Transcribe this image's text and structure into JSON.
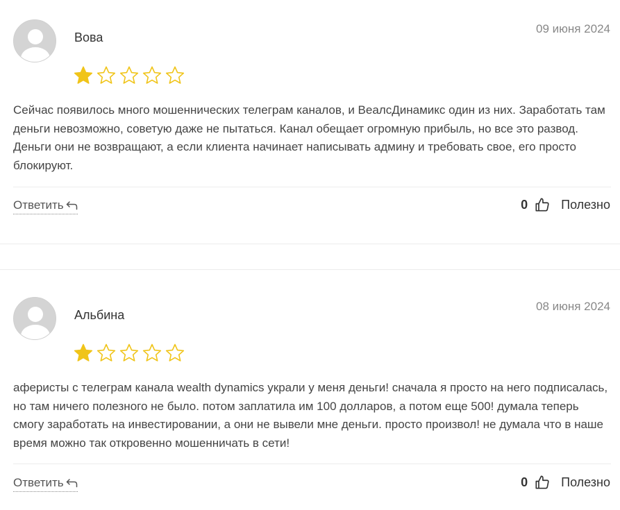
{
  "reviews": [
    {
      "author": "Вова",
      "date": "09 июня 2024",
      "rating": 1,
      "max_rating": 5,
      "text": "Сейчас появилось много мошеннических телеграм каналов, и ВеалсДинамикс один из них. Заработать там деньги невозможно, советую даже не пытаться. Канал обещает огромную прибыль, но все это развод. Деньги они не возвращают, а если клиента начинает написывать админу и требовать свое, его просто блокируют.",
      "reply_label": "Ответить",
      "useful_count": "0",
      "useful_label": "Полезно"
    },
    {
      "author": "Альбина",
      "date": "08 июня 2024",
      "rating": 1,
      "max_rating": 5,
      "text": "аферисты с телеграм канала wealth dynamics украли у меня деньги! сначала я просто на него подписалась, но там ничего полезного не было. потом заплатила им 100 долларов, а потом еще 500! думала теперь смогу заработать на инвестировании, а они не вывели мне деньги. просто произвол! не думала что в наше время можно так откровенно мошенничать в сети!",
      "reply_label": "Ответить",
      "useful_count": "0",
      "useful_label": "Полезно"
    }
  ],
  "icons": {
    "avatar": "default-user-avatar",
    "star_filled": "star-filled-icon",
    "star_empty": "star-outline-icon",
    "reply": "reply-arrow-icon",
    "like": "thumbs-up-icon"
  },
  "colors": {
    "star": "#f0c419",
    "text": "#444444",
    "muted": "#888888",
    "divider": "#ececec"
  }
}
